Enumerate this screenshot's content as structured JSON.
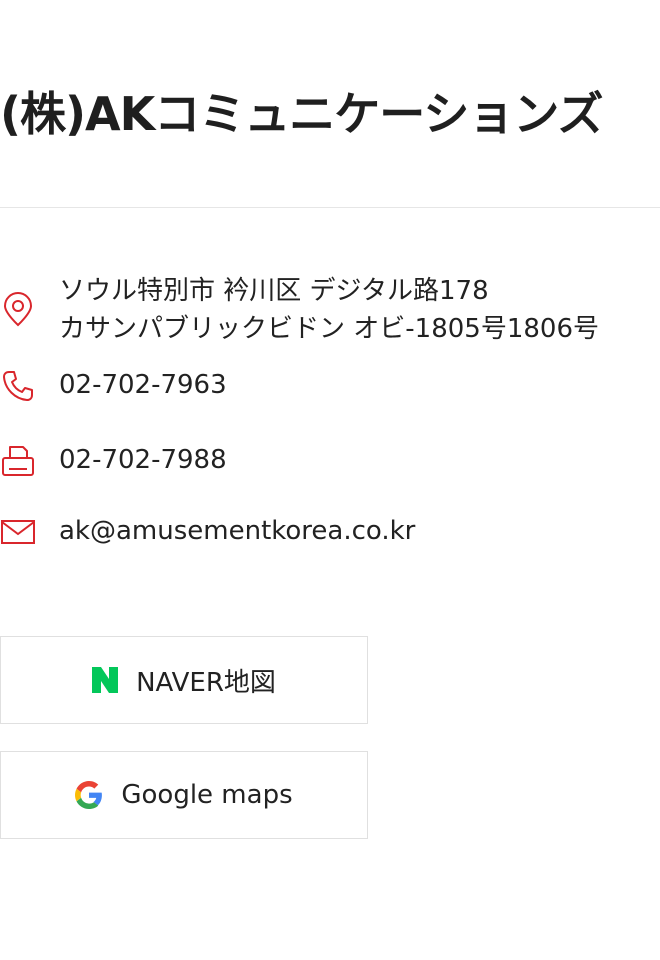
{
  "company": {
    "name": "(株)AKコミュニケーションズ"
  },
  "contact": {
    "address_line1": "ソウル特別市 衿川区 デジタル路178",
    "address_line2": "カサンパブリックビドン オビ-1805号1806号",
    "phone": "02-702-7963",
    "fax": "02-702-7988",
    "email": "ak@amusementkorea.co.kr"
  },
  "maps": {
    "naver_label": "NAVER地図",
    "google_label": "Google maps"
  },
  "colors": {
    "icon_accent": "#d9262c",
    "naver_green": "#03c75a",
    "divider": "#e6e6e6"
  },
  "icons": {
    "address": "map-pin-icon",
    "phone": "phone-icon",
    "fax": "printer-icon",
    "email": "mail-icon"
  }
}
